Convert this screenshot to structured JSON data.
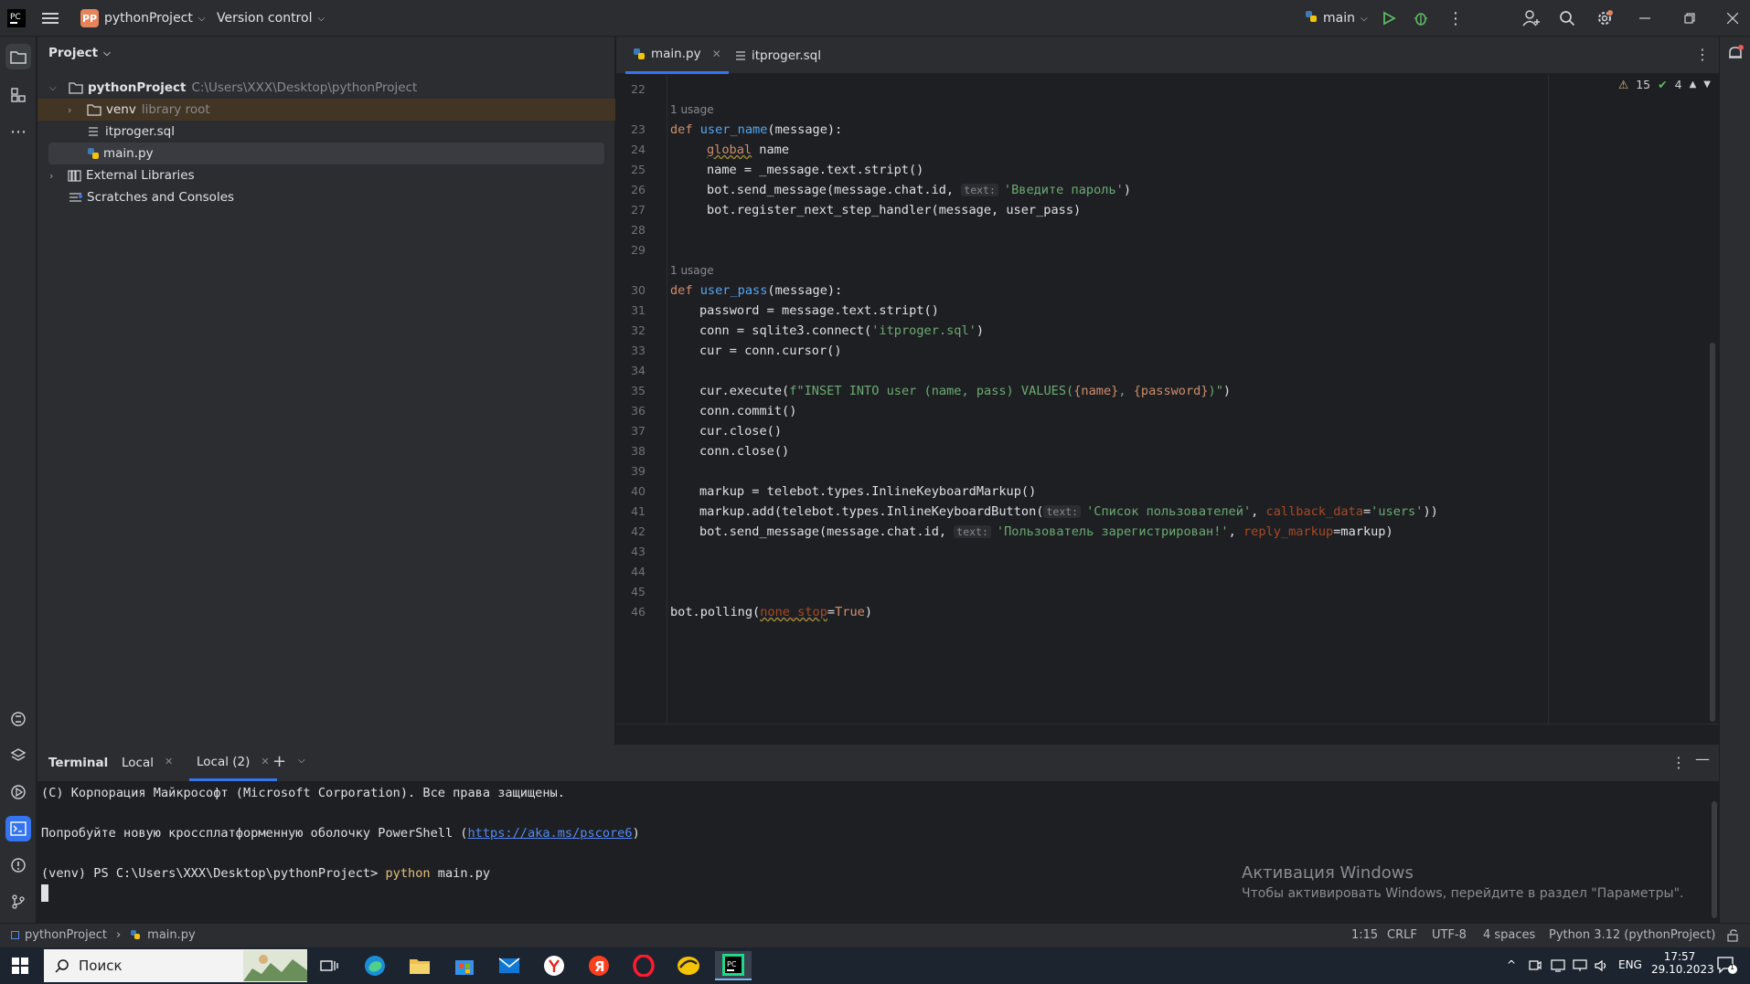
{
  "titlebar": {
    "app_badge": "PP",
    "project_name": "pythonProject",
    "version_control": "Version control",
    "branch": "main"
  },
  "project_panel": {
    "header": "Project",
    "items": [
      {
        "label": "pythonProject",
        "hint": "C:\\Users\\XXX\\Desktop\\pythonProject"
      },
      {
        "label": "venv",
        "hint": "library root"
      },
      {
        "label": "itproger.sql",
        "hint": ""
      },
      {
        "label": "main.py",
        "hint": ""
      },
      {
        "label": "External Libraries",
        "hint": ""
      },
      {
        "label": "Scratches and Consoles",
        "hint": ""
      }
    ]
  },
  "editor": {
    "tabs": [
      {
        "label": "main.py"
      },
      {
        "label": "itproger.sql"
      }
    ],
    "inspections": {
      "warnings": "15",
      "checks": "4"
    },
    "usage_label": "1 usage",
    "line_numbers": [
      "22",
      "23",
      "24",
      "25",
      "26",
      "27",
      "28",
      "29",
      "30",
      "31",
      "32",
      "33",
      "34",
      "35",
      "36",
      "37",
      "38",
      "39",
      "40",
      "41",
      "42",
      "43",
      "44",
      "45",
      "46"
    ],
    "hints": {
      "text": "text:"
    },
    "code": {
      "l23a": "def ",
      "l23b": "user_name",
      "l23c": "(message):",
      "l24a": "global",
      "l24b": " name",
      "l25": "name = _message.text.stript()",
      "l26a": "bot.send_message(message.chat.id, ",
      "l26b": "'Введите пароль'",
      "l26c": ")",
      "l27": "bot.register_next_step_handler(message, user_pass)",
      "l30a": "def ",
      "l30b": "user_pass",
      "l30c": "(message):",
      "l31": "password = message.text.stript()",
      "l32a": "conn = sqlite3.connect(",
      "l32b": "'itproger.sql'",
      "l32c": ")",
      "l33": "cur = conn.cursor()",
      "l35a": "cur.execute(",
      "l35b": "f\"INSET INTO user (name, pass) VALUES(",
      "l35c": "{name}",
      "l35d": ", ",
      "l35e": "{password}",
      "l35f": ")\"",
      "l35g": ")",
      "l36": "conn.commit()",
      "l37": "cur.close()",
      "l38": "conn.close()",
      "l40": "markup = telebot.types.InlineKeyboardMarkup()",
      "l41a": "markup.add(telebot.types.InlineKeyboardButton(",
      "l41b": "'Список пользователей'",
      "l41c": ", ",
      "l41d": "callback_data",
      "l41e": "=",
      "l41f": "'users'",
      "l41g": "))",
      "l42a": "bot.send_message(message.chat.id, ",
      "l42b": "'Пользователь зарегистрирован!'",
      "l42c": ", ",
      "l42d": "reply_markup",
      "l42e": "=markup)",
      "l46a": "bot.polling(",
      "l46b": "none_stop",
      "l46c": "=",
      "l46d": "True",
      "l46e": ")"
    }
  },
  "terminal": {
    "title": "Terminal",
    "tabs": [
      {
        "label": "Local"
      },
      {
        "label": "Local (2)"
      }
    ],
    "lines": {
      "l1": "(C) Корпорация Майкрософт (Microsoft Corporation). Все права защищены.",
      "l2a": "Попробуйте новую кроссплатформенную оболочку PowerShell (",
      "l2b": "https://aka.ms/pscore6",
      "l2c": ")",
      "l3a": "(venv) PS C:\\Users\\XXX\\Desktop\\pythonProject> ",
      "l3b": "python",
      "l3c": " main.py"
    },
    "watermark_title": "Активация Windows",
    "watermark_text": "Чтобы активировать Windows, перейдите в раздел \"Параметры\"."
  },
  "statusbar": {
    "crumb_project": "pythonProject",
    "crumb_file": "main.py",
    "position": "1:15",
    "line_sep": "CRLF",
    "encoding": "UTF-8",
    "indent": "4 spaces",
    "interpreter": "Python 3.12 (pythonProject)"
  },
  "taskbar": {
    "search_placeholder": "Поиск",
    "lang": "ENG",
    "time": "17:57",
    "date": "29.10.2023",
    "notification_count": "1"
  },
  "colors": {
    "accent": "#3574f0",
    "ide_bg": "#1e1f22",
    "panel_bg": "#2b2d30",
    "run_green": "#5fb865"
  }
}
